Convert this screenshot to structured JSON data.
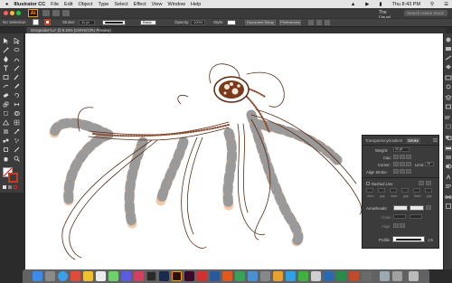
{
  "menubar": {
    "app_name": "Illustrator CC",
    "items": [
      "File",
      "Edit",
      "Object",
      "Type",
      "Select",
      "Effect",
      "View",
      "Window",
      "Help"
    ],
    "right": {
      "clock": "Thu 8:43 PM"
    }
  },
  "appbar": {
    "logo": "Ai",
    "workspace": "The Usual",
    "search_placeholder": "Search Adobe Stock"
  },
  "controlbar": {
    "selection": "No Selection",
    "stroke_label": "Stroke:",
    "stroke_value": "11 pt",
    "style_label": "Basic",
    "opacity_label": "Opacity:",
    "opacity_value": "100%",
    "style2_label": "Style:",
    "doc_setup": "Document Setup",
    "preferences": "Preferences"
  },
  "document": {
    "tab_title": "Octopodes*Lu* @ 8.33% (CMYK/CPU Preview)"
  },
  "stroke_panel": {
    "tabs": [
      "Transparency",
      "Gradient",
      "Stroke"
    ],
    "active_tab": "Stroke",
    "weight_label": "Weight:",
    "weight_value": "11 pt",
    "cap_label": "Cap:",
    "corner_label": "Corner:",
    "limit_label": "Limit:",
    "limit_value": "10",
    "align_label": "Align Stroke:",
    "dashed_label": "Dashed Line",
    "dash_headers": [
      "dash",
      "gap",
      "dash",
      "gap",
      "dash",
      "gap"
    ],
    "arrowheads_label": "Arrowheads:",
    "scale_label": "Scale:",
    "align2_label": "Align:",
    "profile_label": "Profile:",
    "profile_value": "1:5"
  },
  "colors": {
    "tentacle_light": "#f6c9a6",
    "tentacle_band": "#9a9a9a",
    "ink": "#5a2a14",
    "accent": "#cc3a20"
  }
}
